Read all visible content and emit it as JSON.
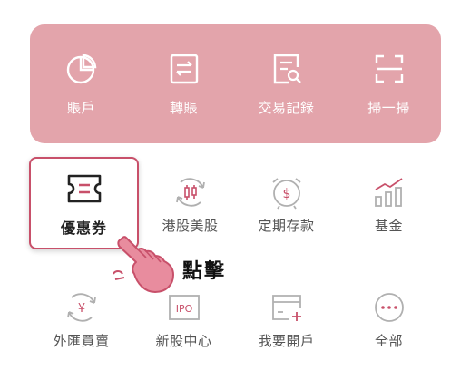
{
  "top_menu": {
    "items": [
      {
        "label": "賬戶",
        "icon": "pie-chart-icon"
      },
      {
        "label": "轉賬",
        "icon": "transfer-icon"
      },
      {
        "label": "交易記錄",
        "icon": "transaction-record-icon"
      },
      {
        "label": "掃一掃",
        "icon": "scan-icon"
      }
    ]
  },
  "grid": {
    "row1": [
      {
        "label": "優惠券",
        "icon": "coupon-icon"
      },
      {
        "label": "港股美股",
        "icon": "stock-chart-icon"
      },
      {
        "label": "定期存款",
        "icon": "time-deposit-icon"
      },
      {
        "label": "基金",
        "icon": "fund-bars-icon"
      }
    ],
    "row2": [
      {
        "label": "外匯買賣",
        "icon": "yen-exchange-icon"
      },
      {
        "label": "新股中心",
        "icon": "ipo-icon"
      },
      {
        "label": "我要開戶",
        "icon": "open-account-icon"
      },
      {
        "label": "全部",
        "icon": "more-dots-icon"
      }
    ]
  },
  "annotation": {
    "click_text": "點擊",
    "icon": "pointing-hand-icon"
  },
  "colors": {
    "card": "#e3a4ab",
    "highlight_border": "#c8506a",
    "hand_fill": "#e88c9e",
    "icon_gray": "#b0b0b0",
    "text_gray": "#555555"
  }
}
